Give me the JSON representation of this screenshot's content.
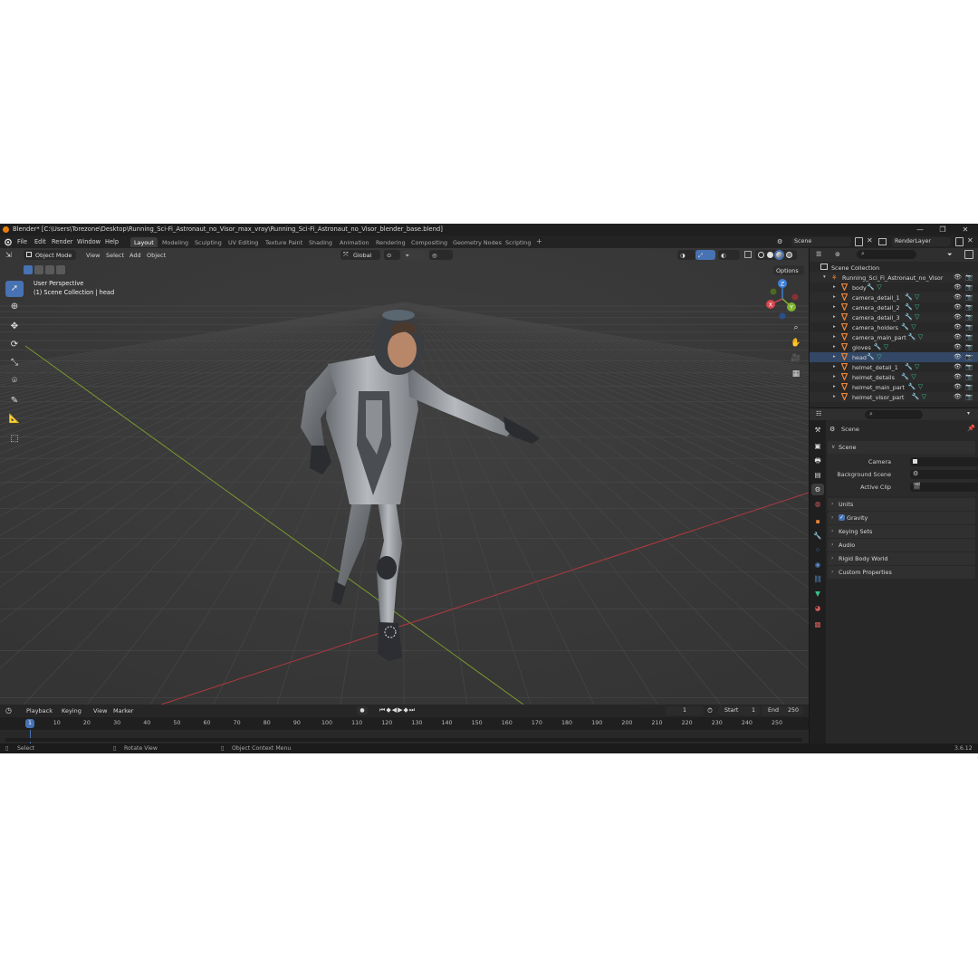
{
  "window": {
    "title": "Blender* [C:\\Users\\Torezone\\Desktop\\Running_Sci-Fi_Astronaut_no_Visor_max_vray\\Running_Sci-Fi_Astronaut_no_Visor_blender_base.blend]",
    "minimize": "—",
    "maximize": "❐",
    "close": "✕"
  },
  "menu": [
    "File",
    "Edit",
    "Render",
    "Window",
    "Help"
  ],
  "workspaces": [
    "Layout",
    "Modeling",
    "Sculpting",
    "UV Editing",
    "Texture Paint",
    "Shading",
    "Animation",
    "Rendering",
    "Compositing",
    "Geometry Nodes",
    "Scripting",
    "+"
  ],
  "active_workspace": "Layout",
  "scene_selector": "Scene",
  "view_layer_selector": "RenderLayer",
  "viewport": {
    "mode": "Object Mode",
    "menus": [
      "View",
      "Select",
      "Add",
      "Object"
    ],
    "transform_orientation": "Global",
    "options_label": "Options",
    "overlay_line1": "User Perspective",
    "overlay_line2": "(1) Scene Collection | head",
    "gizmo_labels": {
      "z": "Z",
      "y": "Y",
      "x": "X"
    }
  },
  "timeline": {
    "menus": [
      "Playback",
      "Keying",
      "View",
      "Marker"
    ],
    "current_frame": "1",
    "start_label": "Start",
    "start_value": "1",
    "end_label": "End",
    "end_value": "250",
    "ruler_current": "1",
    "ruler_ticks": [
      "10",
      "20",
      "30",
      "40",
      "50",
      "60",
      "70",
      "80",
      "90",
      "100",
      "110",
      "120",
      "130",
      "140",
      "150",
      "160",
      "170",
      "180",
      "190",
      "200",
      "210",
      "220",
      "230",
      "240",
      "250"
    ]
  },
  "statusbar": {
    "select": "Select",
    "rotate": "Rotate View",
    "context": "Object Context Menu",
    "version": "3.6.12"
  },
  "outliner": {
    "root": "Scene Collection",
    "collection": "Running_Sci_Fi_Astronaut_no_Visor",
    "objects": [
      "body",
      "camera_detail_1",
      "camera_detail_2",
      "camera_detail_3",
      "camera_holders",
      "camera_main_part",
      "gloves",
      "head",
      "helmet_detail_1",
      "helmet_details",
      "helmet_main_part",
      "helmet_visor_part"
    ]
  },
  "properties": {
    "context_name": "Scene",
    "scene_panel": "Scene",
    "camera_label": "Camera",
    "background_scene_label": "Background Scene",
    "active_clip_label": "Active Clip",
    "panels": [
      "Units",
      "Gravity",
      "Keying Sets",
      "Audio",
      "Rigid Body World",
      "Custom Properties"
    ],
    "gravity_checked": true
  },
  "colors": {
    "accent": "#4772b3",
    "brand_orange": "#e87d0d",
    "mesh_orange": "#e8843a",
    "mesh_green": "#3ac48d",
    "axis_x": "#d4464e",
    "axis_y": "#7fb32e",
    "axis_z": "#3d7fd6"
  }
}
